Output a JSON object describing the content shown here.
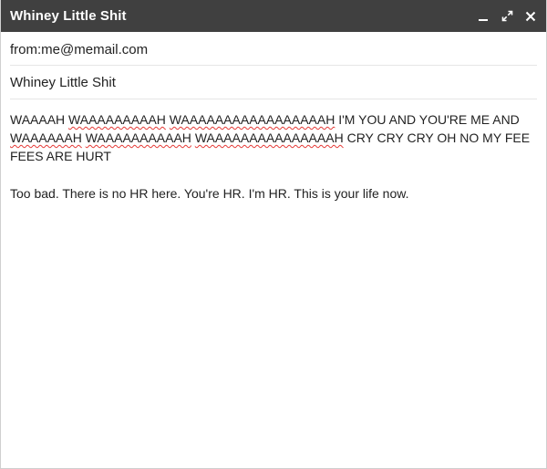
{
  "window": {
    "title": "Whiney Little Shit"
  },
  "compose": {
    "from": "from:me@memail.com",
    "subject": "Whiney Little Shit",
    "body_line1_part1": "WAAAAH ",
    "body_line1_word1": "WAAAAAAAAAH",
    "body_line1_sp1": " ",
    "body_line1_word2": "WAAAAAAAAAAAAAAAAAH",
    "body_line1_part2": " I'M YOU AND YOU'RE ME AND ",
    "body_line2_word1": "WAAAAAAH",
    "body_line2_sp1": " ",
    "body_line2_word2": "WAAAAAAAAAAH",
    "body_line2_sp2": " ",
    "body_line2_word3": "WAAAAAAAAAAAAAAAH",
    "body_line2_part": " CRY CRY CRY OH NO MY FEE FEES ARE HURT",
    "body_paragraph2": "Too bad. There is no HR here. You're HR. I'm HR. This is your life now."
  },
  "colors": {
    "titlebar": "#404040",
    "spellcheck": "#e53935"
  },
  "icons": [
    "minimize-icon",
    "expand-icon",
    "close-icon"
  ]
}
